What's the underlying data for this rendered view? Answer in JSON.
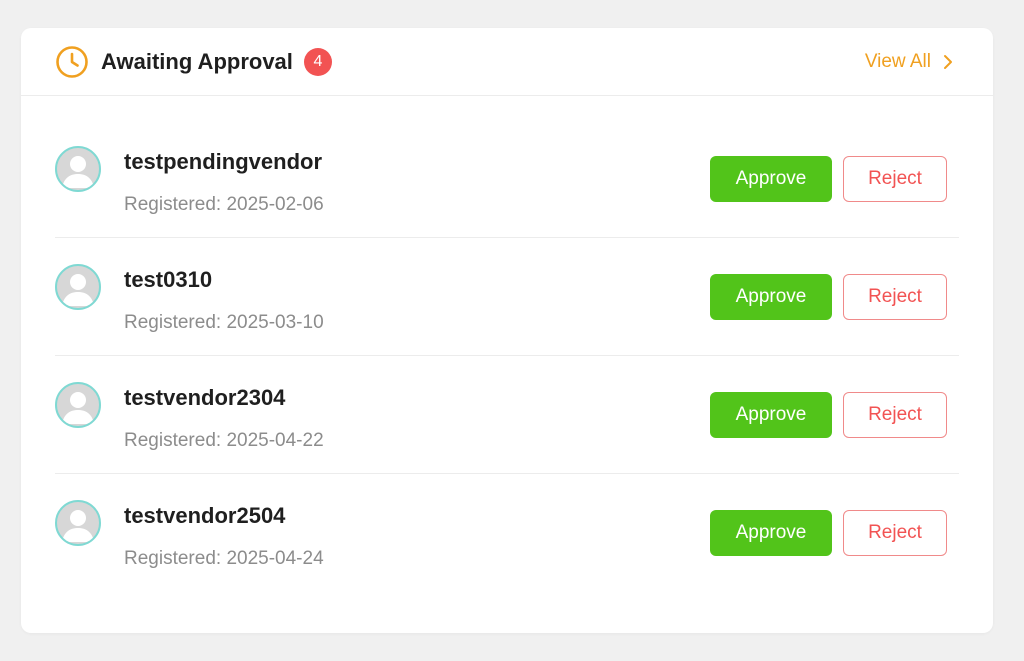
{
  "header": {
    "title": "Awaiting Approval",
    "count": "4",
    "view_all": "View All",
    "icon": "clock-icon"
  },
  "colors": {
    "accent": "#f0a020",
    "approve": "#52c41a",
    "reject": "#f25353",
    "badge": "#f25353"
  },
  "vendors": [
    {
      "name": "testpendingvendor",
      "registered": "Registered: 2025-02-06",
      "approve_label": "Approve",
      "reject_label": "Reject"
    },
    {
      "name": "test0310",
      "registered": "Registered: 2025-03-10",
      "approve_label": "Approve",
      "reject_label": "Reject"
    },
    {
      "name": "testvendor2304",
      "registered": "Registered: 2025-04-22",
      "approve_label": "Approve",
      "reject_label": "Reject"
    },
    {
      "name": "testvendor2504",
      "registered": "Registered: 2025-04-24",
      "approve_label": "Approve",
      "reject_label": "Reject"
    }
  ]
}
